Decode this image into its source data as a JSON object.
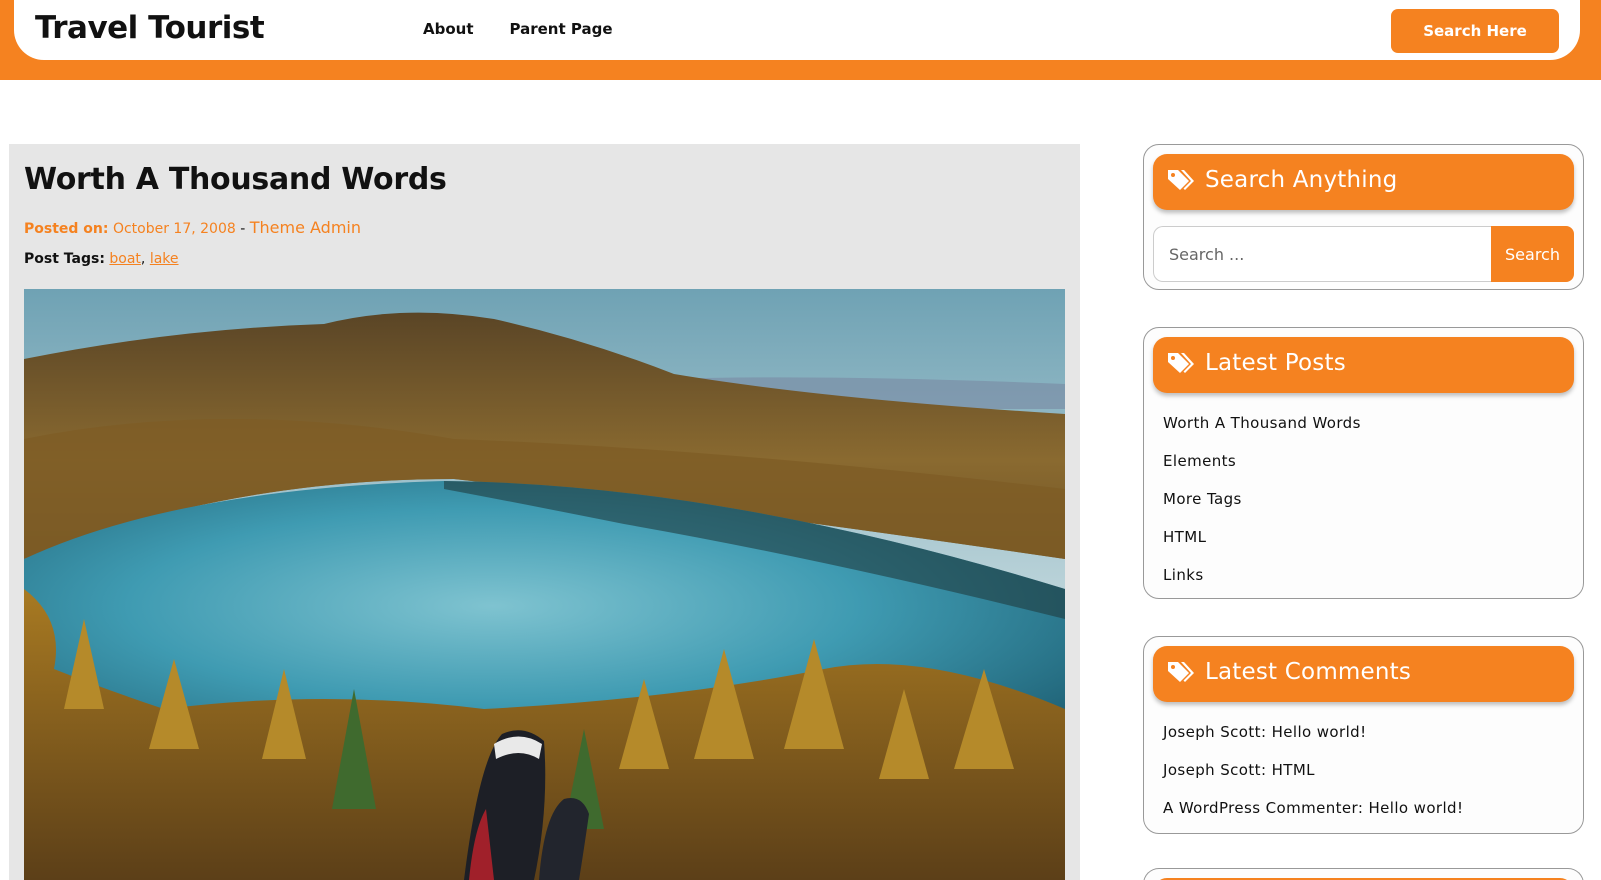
{
  "header": {
    "site_title": "Travel Tourist",
    "nav": [
      {
        "label": "About"
      },
      {
        "label": "Parent Page"
      }
    ],
    "search_button": "Search Here"
  },
  "post": {
    "title": "Worth A Thousand Words",
    "posted_on_label": "Posted on:",
    "date": "October 17, 2008",
    "separator": " - ",
    "author": "Theme Admin",
    "tags_label": "Post Tags:",
    "tags": [
      "boat",
      "lake"
    ],
    "tag_separator": ", "
  },
  "sidebar": {
    "search_widget": {
      "title": "Search Anything",
      "placeholder": "Search ...",
      "button": "Search"
    },
    "latest_posts": {
      "title": "Latest Posts",
      "items": [
        "Worth A Thousand Words",
        "Elements",
        "More Tags",
        "HTML",
        "Links"
      ]
    },
    "latest_comments": {
      "title": "Latest Comments",
      "items": [
        {
          "author": "Joseph Scott",
          "sep": ": ",
          "post": "Hello world!"
        },
        {
          "author": "Joseph Scott",
          "sep": ": ",
          "post": "HTML"
        },
        {
          "author": "A WordPress Commenter",
          "sep": ": ",
          "post": "Hello world!"
        }
      ]
    }
  },
  "colors": {
    "accent": "#f58220",
    "post_background": "#e6e6e6",
    "text": "#111111"
  },
  "icons": [
    "tag-icon"
  ]
}
